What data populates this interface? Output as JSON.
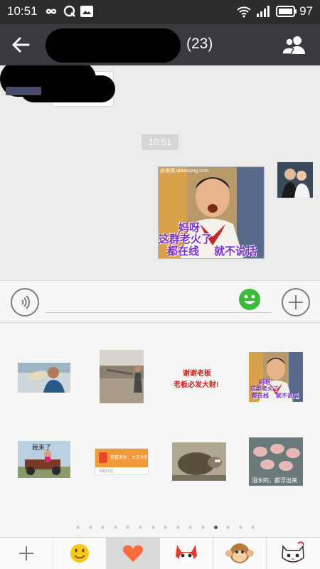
{
  "status_bar": {
    "time": "10:51",
    "icons": [
      "infinity-icon",
      "q-icon",
      "image-icon",
      "wifi-icon",
      "signal-icon",
      "battery-icon"
    ],
    "battery": "97"
  },
  "title_bar": {
    "member_count": "(23)"
  },
  "chat": {
    "timestamp": "10:51",
    "sticker_message": {
      "watermark": "@表情 qbiaoqing com",
      "lines": [
        "妈呀",
        "这群老火了",
        "都在线",
        "就不说话"
      ]
    }
  },
  "input_bar": {
    "voice_icon": "voice-icon",
    "emoji_icon": "emoji-icon",
    "plus_icon": "plus-icon"
  },
  "sticker_panel": {
    "stickers": [
      {
        "name": "sticker-man-drinking"
      },
      {
        "name": "sticker-man-street"
      },
      {
        "name": "sticker-thanks-boss",
        "lines": [
          "谢谢老板",
          "老板必发大财!"
        ]
      },
      {
        "name": "sticker-omg-online",
        "lines": [
          "妈呀",
          "这群老火了",
          "都在线",
          "就不说话"
        ]
      },
      {
        "name": "sticker-here-i-come",
        "caption": "我来了"
      },
      {
        "name": "sticker-red-packet",
        "caption": "恭喜发财，大吉大利",
        "sub": "领取红包"
      },
      {
        "name": "sticker-tortoise"
      },
      {
        "name": "sticker-pigs",
        "caption": "泪水的，都浮出来"
      }
    ],
    "page_count": 15,
    "active_page": 11
  },
  "tab_bar": {
    "tabs": [
      "add-tab",
      "emoji-tab",
      "favorites-tab",
      "fox-sticker-tab",
      "monkey-sticker-tab",
      "cat-sticker-tab"
    ],
    "selected": "favorites-tab"
  },
  "colors": {
    "titlebar": "#393a3e",
    "statusbar": "#2c2c2c",
    "chat_bg": "#ebebeb",
    "emoji_green": "#3dbb38",
    "heart_orange": "#ff6a3d"
  }
}
